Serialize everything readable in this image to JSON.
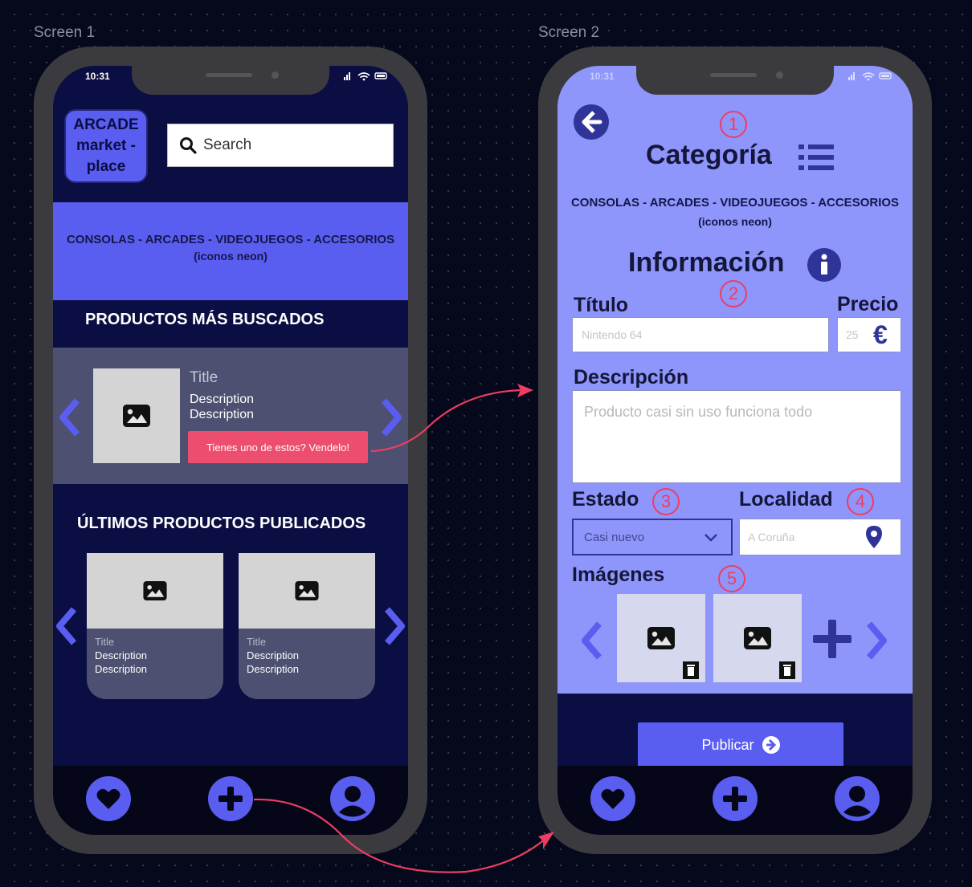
{
  "board": {
    "screen1_label": "Screen 1",
    "screen2_label": "Screen 2"
  },
  "status_bar": {
    "time": "10:31"
  },
  "screen1": {
    "logo_lines": [
      "ARCADE",
      "market -",
      "place"
    ],
    "search_placeholder": "Search",
    "categories": "CONSOLAS - ARCADES - VIDEOJUEGOS - ACCESORIOS",
    "categories_note": "(iconos neon)",
    "most_searched_title": "PRODUCTOS MÁS BUSCADOS",
    "featured": {
      "title": "Title",
      "description_1": "Description",
      "description_2": "Description",
      "sell_button": "Tienes uno de estos? Vendelo!"
    },
    "latest_title": "ÚLTIMOS PRODUCTOS PUBLICADOS",
    "latest_items": [
      {
        "title": "Title",
        "description_1": "Description",
        "description_2": "Description"
      },
      {
        "title": "Title",
        "description_1": "Description",
        "description_2": "Description"
      }
    ]
  },
  "screen2": {
    "category_heading": "Categoría",
    "categories": "CONSOLAS - ARCADES - VIDEOJUEGOS - ACCESORIOS",
    "categories_note": "(iconos neon)",
    "info_heading": "Información",
    "title_label": "Título",
    "title_placeholder": "Nintendo 64",
    "price_label": "Precio",
    "price_value": "25",
    "currency_symbol": "€",
    "description_label": "Descripción",
    "description_placeholder": "Producto casi sin uso funciona todo",
    "state_label": "Estado",
    "state_selected": "Casi nuevo",
    "location_label": "Localidad",
    "location_placeholder": "A Coruña",
    "images_label": "Imágenes",
    "publish_button": "Publicar",
    "annotations": [
      "1",
      "2",
      "3",
      "4",
      "5"
    ]
  },
  "colors": {
    "canvas": "#06081c",
    "phone_frame": "#3b3b3f",
    "screen1_bg": "#0b0e42",
    "accent": "#5a5ef0",
    "screen2_bg": "#8f96fb",
    "card": "#4d5070",
    "cta_pink": "#ed4d6e",
    "tab_bar": "#050617"
  },
  "icons": [
    "search-icon",
    "image-icon",
    "chevron-left-icon",
    "chevron-right-icon",
    "heart-icon",
    "plus-icon",
    "user-icon",
    "arrow-left-icon",
    "list-icon",
    "info-icon",
    "euro-icon",
    "chevron-down-icon",
    "location-pin-icon",
    "trash-icon",
    "arrow-right-circle-icon"
  ]
}
